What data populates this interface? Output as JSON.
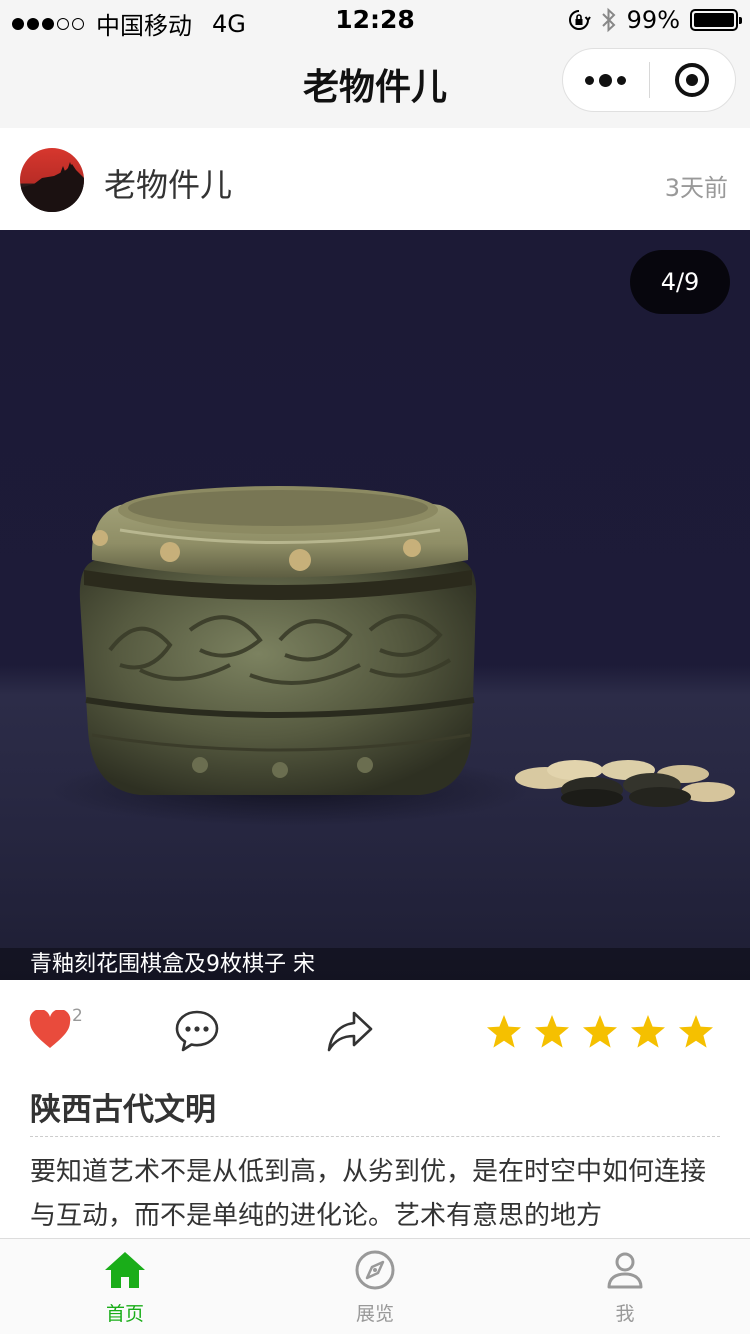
{
  "status_bar": {
    "carrier": "中国移动",
    "network": "4G",
    "time": "12:28",
    "battery": "99%",
    "battery_level": 0.99
  },
  "nav": {
    "title": "老物件儿"
  },
  "post": {
    "author": "老物件儿",
    "time": "3天前",
    "photo_counter": "4/9",
    "photo_caption": "青釉刻花围棋盒及9枚棋子 宋",
    "like_count": "2",
    "rating": 5,
    "rating_max": 5,
    "title": "陕西古代文明",
    "body": "要知道艺术不是从低到高，从劣到优，是在时空中如何连接与互动，而不是单纯的进化论。艺术有意思的地方"
  },
  "colors": {
    "like": "#e94b3c",
    "star": "#f5c000",
    "tab_active": "#1aad19",
    "tab_inactive": "#999999"
  },
  "tabs": [
    {
      "label": "首页",
      "icon": "home-icon",
      "active": true
    },
    {
      "label": "展览",
      "icon": "compass-icon",
      "active": false
    },
    {
      "label": "我",
      "icon": "user-icon",
      "active": false
    }
  ]
}
